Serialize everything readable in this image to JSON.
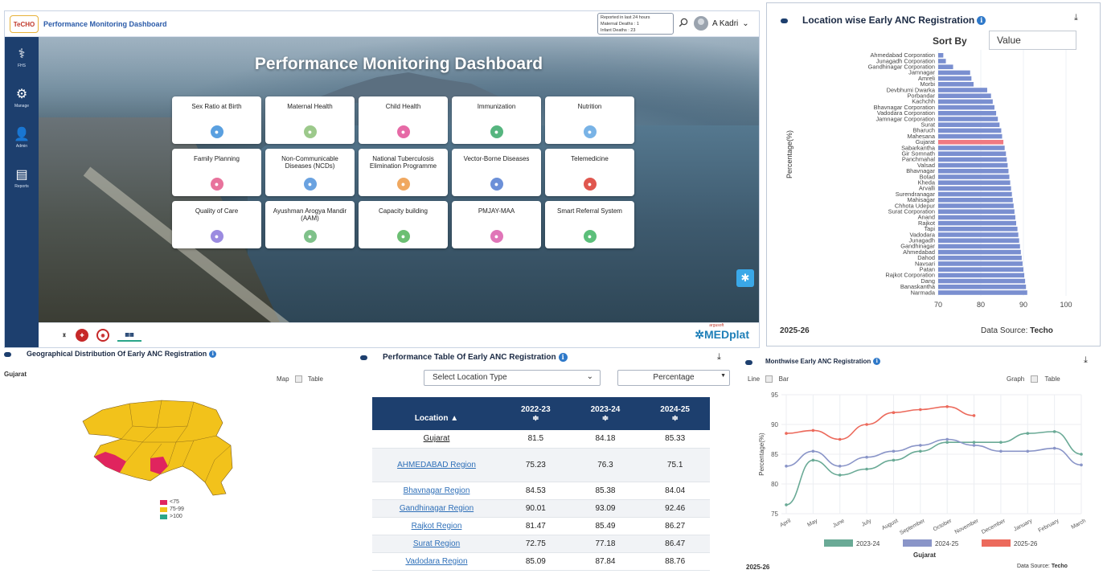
{
  "app": {
    "brand": "TeCHO",
    "title": "Performance Monitoring Dashboard",
    "notice": [
      "Reported in last 24 hours",
      "Maternal Deaths : 1",
      "Infant Deaths : 23"
    ],
    "user": "A Kadri",
    "user_caret": "⌄",
    "hero_title": "Performance Monitoring Dashboard"
  },
  "sidebar": {
    "items": [
      {
        "label": "FHS",
        "icon": "family-health-icon"
      },
      {
        "label": "Manage",
        "icon": "gears-icon"
      },
      {
        "label": "Admin",
        "icon": "admin-user-icon"
      },
      {
        "label": "Reports",
        "icon": "reports-icon"
      }
    ]
  },
  "modules": [
    {
      "label": "Sex Ratio at Birth",
      "color": "#5aa0e0",
      "icon": "gender-icon"
    },
    {
      "label": "Maternal Health",
      "color": "#9cc98b",
      "icon": "mother-icon"
    },
    {
      "label": "Child Health",
      "color": "#e66aa6",
      "icon": "child-icon"
    },
    {
      "label": "Immunization",
      "color": "#56b57f",
      "icon": "syringe-icon"
    },
    {
      "label": "Nutrition",
      "color": "#79b3e6",
      "icon": "nutrition-icon"
    },
    {
      "label": "Family Planning",
      "color": "#e8739c",
      "icon": "family-icon"
    },
    {
      "label": "Non-Communicable Diseases (NCDs)",
      "color": "#6aa2e0",
      "icon": "ncd-icon"
    },
    {
      "label": "National Tuberculosis Elimination Programme",
      "color": "#f0a860",
      "icon": "tb-icon"
    },
    {
      "label": "Vector-Borne Diseases",
      "color": "#6c90d8",
      "icon": "mosquito-icon"
    },
    {
      "label": "Telemedicine",
      "color": "#e0574f",
      "icon": "telemedicine-icon"
    },
    {
      "label": "Quality of Care",
      "color": "#9b8be0",
      "icon": "quality-icon"
    },
    {
      "label": "Ayushman Arogya Mandir (AAM)",
      "color": "#7fc18a",
      "icon": "building-icon"
    },
    {
      "label": "Capacity building",
      "color": "#6cbf73",
      "icon": "training-icon"
    },
    {
      "label": "PMJAY-MAA",
      "color": "#e075b8",
      "icon": "card-icon"
    },
    {
      "label": "Smart Referral System",
      "color": "#5cbf7a",
      "icon": "referral-icon"
    }
  ],
  "footer": {
    "medplat": "MEDplat",
    "medplat_tag": "argusoft"
  },
  "bar_panel": {
    "title": "Location wise Early ANC Registration",
    "sort_by_label": "Sort By",
    "sort_value": "Value",
    "y_label": "Percentage(%)",
    "year": "2025-26",
    "source_label": "Data Source:",
    "source_value": "Techo"
  },
  "map_panel": {
    "title": "Geographical Distribution Of Early ANC Registration",
    "region": "Gujarat",
    "map_label": "Map",
    "table_label": "Table",
    "legend": [
      {
        "label": "<75",
        "color": "#e0245e"
      },
      {
        "label": "75-99",
        "color": "#f2c21b"
      },
      {
        "label": ">100",
        "color": "#2aa68a"
      }
    ],
    "map_colors": {
      "base": "#f2c21b",
      "low": "#e0245e",
      "border": "#7a5a1a"
    }
  },
  "table_panel": {
    "title": "Performance Table Of Early ANC Registration",
    "location_type_placeholder": "Select Location Type",
    "metric": "Percentage",
    "sort_icon": "≑",
    "columns": [
      "Location ▲",
      "2022-23",
      "2023-24",
      "2024-25"
    ],
    "rows": [
      [
        "Gujarat",
        "81.5",
        "84.18",
        "85.33"
      ],
      [
        "AHMEDABAD Region",
        "75.23",
        "76.3",
        "75.1"
      ],
      [
        "Bhavnagar Region",
        "84.53",
        "85.38",
        "84.04"
      ],
      [
        "Gandhinagar Region",
        "90.01",
        "93.09",
        "92.46"
      ],
      [
        "Rajkot Region",
        "81.47",
        "85.49",
        "86.27"
      ],
      [
        "Surat Region",
        "72.75",
        "77.18",
        "86.47"
      ],
      [
        "Vadodara Region",
        "85.09",
        "87.84",
        "88.76"
      ]
    ]
  },
  "line_panel": {
    "title": "Monthwise Early ANC Registration",
    "line_label": "Line",
    "bar_label": "Bar",
    "graph_label": "Graph",
    "table_label": "Table",
    "region": "Gujarat",
    "year": "2025-26",
    "source_label": "Data Source:",
    "source_value": "Techo"
  },
  "chart_data": [
    {
      "type": "bar",
      "orientation": "horizontal",
      "title": "Location wise Early ANC Registration",
      "ylabel": "Percentage(%)",
      "xlim": [
        70,
        100
      ],
      "xticks": [
        70,
        80,
        90,
        100
      ],
      "highlight": "Gujarat",
      "colors": {
        "bar": "#7a8fd0",
        "highlight": "#f07a82"
      },
      "categories": [
        "Ahmedabad Corporation",
        "Junagadh Corporation",
        "Gandhinagar Corporation",
        "Jamnagar",
        "Amreli",
        "Morbi",
        "Devbhumi Dwarka",
        "Porbandar",
        "Kachchh",
        "Bhavnagar Corporation",
        "Vadodara Corporation",
        "Jamnagar Corporation",
        "Surat",
        "Bharuch",
        "Mahesana",
        "Gujarat",
        "Sabarkantha",
        "Gir Somnath",
        "Panchmahal",
        "Valsad",
        "Bhavnagar",
        "Botad",
        "Kheda",
        "Arvalli",
        "Surendranagar",
        "Mahisagar",
        "Chhota Udepur",
        "Surat Corporation",
        "Anand",
        "Rajkot",
        "Tapi",
        "Vadodara",
        "Junagadh",
        "Gandhinagar",
        "Ahmedabad",
        "Dahod",
        "Navsari",
        "Patan",
        "Rajkot Corporation",
        "Dang",
        "Banaskantha",
        "Narmada"
      ],
      "values": [
        71.2,
        71.8,
        73.5,
        77.5,
        77.8,
        78.3,
        81.5,
        82.4,
        82.8,
        83.2,
        83.6,
        84.0,
        84.4,
        84.8,
        85.0,
        85.3,
        85.6,
        85.9,
        86.1,
        86.3,
        86.5,
        86.7,
        86.9,
        87.1,
        87.3,
        87.5,
        87.7,
        87.9,
        88.1,
        88.3,
        88.6,
        88.8,
        89.0,
        89.2,
        89.4,
        89.6,
        89.8,
        90.0,
        90.2,
        90.4,
        90.6,
        90.9
      ]
    },
    {
      "type": "line",
      "title": "Monthwise Early ANC Registration",
      "ylabel": "Percentage(%)",
      "xlabel": "Gujarat",
      "ylim": [
        75,
        95
      ],
      "yticks": [
        75,
        80,
        85,
        90,
        95
      ],
      "categories": [
        "April",
        "May",
        "June",
        "July",
        "August",
        "September",
        "October",
        "November",
        "December",
        "January",
        "February",
        "March"
      ],
      "series": [
        {
          "name": "2023-24",
          "color": "#6aaa96",
          "values": [
            76.5,
            84.0,
            81.5,
            82.5,
            84.0,
            85.5,
            87.0,
            87.0,
            87.0,
            88.5,
            88.8,
            85.0
          ]
        },
        {
          "name": "2024-25",
          "color": "#8a95c8",
          "values": [
            83.0,
            85.5,
            83.0,
            84.5,
            85.5,
            86.5,
            87.5,
            86.5,
            85.5,
            85.5,
            86.0,
            83.2
          ]
        },
        {
          "name": "2025-26",
          "color": "#ec6a5c",
          "values": [
            88.5,
            89.0,
            87.5,
            90.0,
            92.0,
            92.5,
            93.0,
            91.5
          ]
        }
      ]
    }
  ]
}
